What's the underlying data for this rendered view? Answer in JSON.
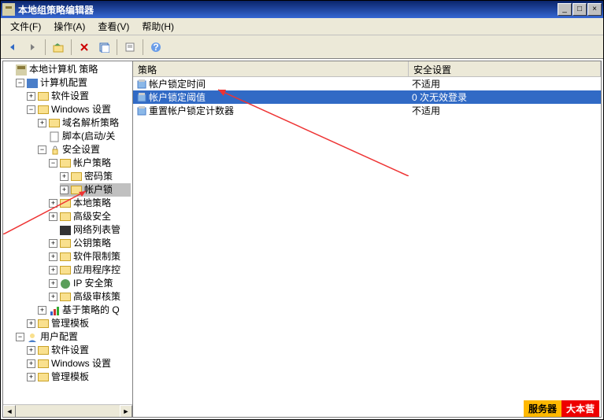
{
  "window": {
    "title": "本地组策略编辑器"
  },
  "menu": {
    "file": "文件(F)",
    "action": "操作(A)",
    "view": "查看(V)",
    "help": "帮助(H)"
  },
  "toolbar_icons": {
    "back": "back-icon",
    "forward": "forward-icon",
    "up": "up-icon",
    "delete": "delete-icon",
    "refresh": "refresh-icon",
    "props": "properties-icon",
    "help": "help-icon"
  },
  "tree": {
    "root": "本地计算机 策略",
    "computer_config": "计算机配置",
    "software_settings": "软件设置",
    "windows_settings": "Windows 设置",
    "dns_policy": "域名解析策略",
    "scripts": "脚本(启动/关",
    "security_settings": "安全设置",
    "account_policy": "帐户策略",
    "password_policy": "密码策",
    "lockout_policy": "帐户锁",
    "local_policy": "本地策略",
    "advanced_security": "高级安全",
    "network_list": "网络列表管",
    "public_key": "公钥策略",
    "software_restrict": "软件限制策",
    "app_control": "应用程序控",
    "ip_security": "IP 安全策",
    "advanced_audit": "高级审核策",
    "policy_based_q": "基于策略的 Q",
    "admin_templates": "管理模板",
    "user_config": "用户配置",
    "u_software_settings": "软件设置",
    "u_windows_settings": "Windows 设置",
    "u_admin_templates": "管理模板"
  },
  "list": {
    "header_policy": "策略",
    "header_security": "安全设置",
    "rows": [
      {
        "name": "帐户锁定时间",
        "value": "不适用"
      },
      {
        "name": "帐户锁定阈值",
        "value": "0 次无效登录"
      },
      {
        "name": "重置帐户锁定计数器",
        "value": "不适用"
      }
    ],
    "selected_index": 1
  },
  "watermark": {
    "p1": "服务器",
    "p2": "大本营"
  },
  "toggle": {
    "expand": "+",
    "collapse": "−"
  }
}
